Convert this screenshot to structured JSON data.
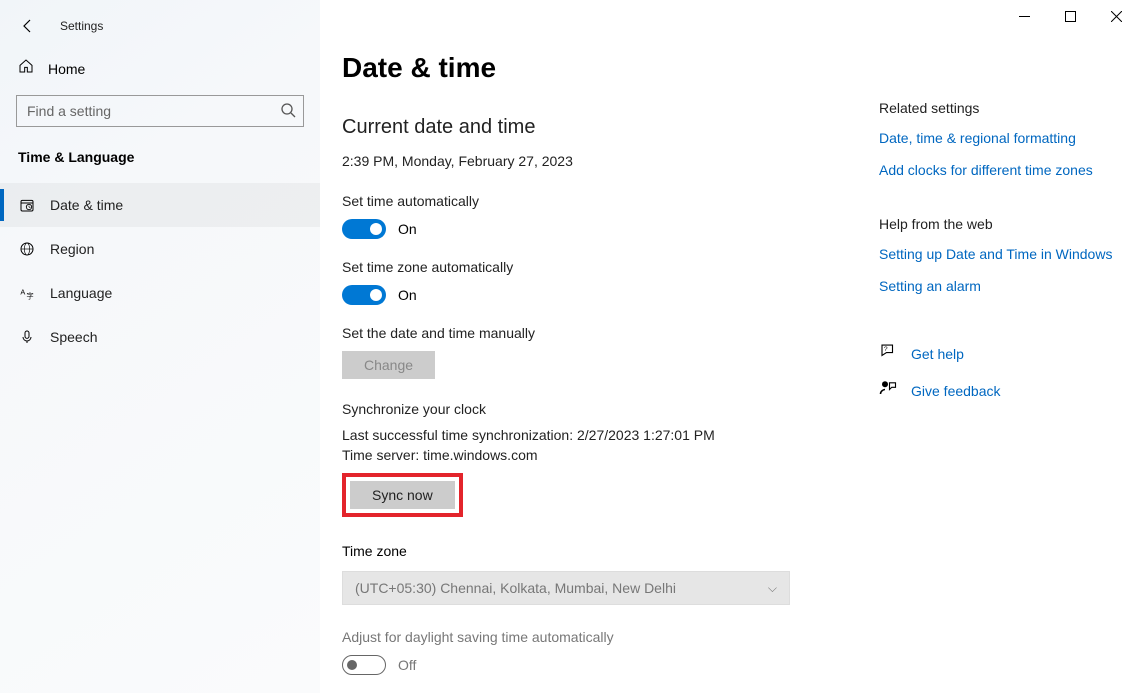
{
  "window": {
    "title": "Settings"
  },
  "sidebar": {
    "home": "Home",
    "search_placeholder": "Find a setting",
    "category": "Time & Language",
    "items": [
      {
        "label": "Date & time"
      },
      {
        "label": "Region"
      },
      {
        "label": "Language"
      },
      {
        "label": "Speech"
      }
    ]
  },
  "main": {
    "title": "Date & time",
    "section_current": "Current date and time",
    "datetime": "2:39 PM, Monday, February 27, 2023",
    "set_time_auto_label": "Set time automatically",
    "set_tz_auto_label": "Set time zone automatically",
    "manual_label": "Set the date and time manually",
    "change_btn": "Change",
    "sync_title": "Synchronize your clock",
    "sync_last": "Last successful time synchronization: 2/27/2023 1:27:01 PM",
    "sync_server": "Time server: time.windows.com",
    "sync_btn": "Sync now",
    "tz_title": "Time zone",
    "tz_value": "(UTC+05:30) Chennai, Kolkata, Mumbai, New Delhi",
    "dst_label": "Adjust for daylight saving time automatically",
    "on": "On",
    "off": "Off"
  },
  "right": {
    "related_heading": "Related settings",
    "link1": "Date, time & regional formatting",
    "link2": "Add clocks for different time zones",
    "help_heading": "Help from the web",
    "help1": "Setting up Date and Time in Windows",
    "help2": "Setting an alarm",
    "get_help": "Get help",
    "feedback": "Give feedback"
  }
}
